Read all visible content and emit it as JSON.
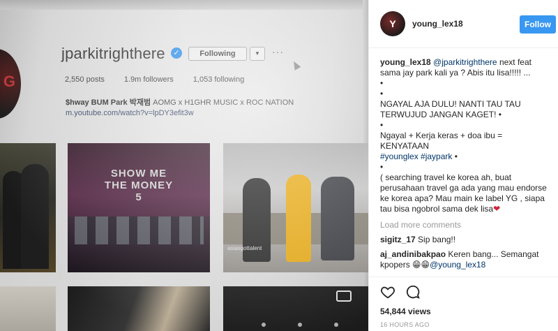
{
  "video": {
    "profile_name": "jparkitrighthere",
    "following_label": "Following",
    "posts": "2,550 posts",
    "followers": "1.9m followers",
    "following": "1,053 following",
    "bio_name": "$hway BUM Park 박재범",
    "bio_rest": " AOMG x H1GHR MUSIC x ROC NATION",
    "link": "m.youtube.com/watch?v=lpDY3efit3w",
    "show_logo": "SHOW ME THE MONEY 5",
    "watermark": "asiasgottalent",
    "avatar_letter": "G"
  },
  "header": {
    "avatar_text": "Y",
    "username": "young_lex18",
    "follow_label": "Follow"
  },
  "caption": {
    "user": "young_lex18",
    "mention": "@jparkitrighthere",
    "l1": " next feat sama jay park kali ya ? Abis itu lisa!!!!! ...",
    "dot": "•",
    "l2": "NGAYAL AJA DULU! NANTI TAU TAU TERWUJUD JANGAN KAGET! •",
    "l3": "Ngayal + Kerja keras + doa ibu = KENYATAAN",
    "hashtags": "#younglex #jaypark",
    "hash_tail": " •",
    "l4": "( searching travel ke korea ah, buat perusahaan travel ga ada yang mau endorse ke korea apa? Mau main ke label YG , siapa tau bisa ngobrol sama dek lisa",
    "l4_emoji": "❤"
  },
  "load_more": "Load more comments",
  "comments": [
    {
      "user": "sigitz_17",
      "text": " Sip bang!!"
    },
    {
      "user": "aj_andinibakpao",
      "text": " Keren bang... Semangat kpopers ",
      "emoji": "😁😁",
      "mention": "@young_lex18"
    }
  ],
  "stats": {
    "views": "54,844 views",
    "ago": "16 HOURS AGO"
  },
  "colors": {
    "follow_blue": "#3897f0",
    "link_blue": "#003569"
  }
}
